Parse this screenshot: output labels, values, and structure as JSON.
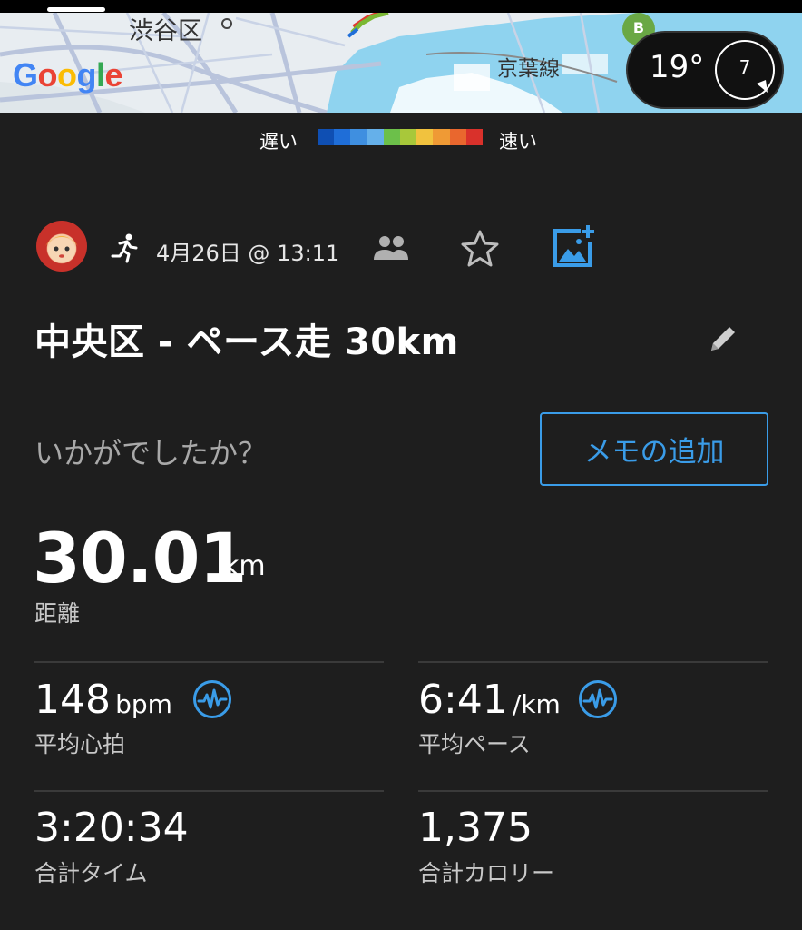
{
  "map": {
    "district_label": "渋谷区",
    "rail_label": "京葉線",
    "google_logo": "Google",
    "marker_letter": "B",
    "weather": {
      "temperature": "19°",
      "wind": "7"
    }
  },
  "pace_legend": {
    "slow_label": "遅い",
    "fast_label": "速い",
    "colors": [
      "#0f4fb3",
      "#1f6ed8",
      "#3f8fe0",
      "#65b0ea",
      "#6cc04a",
      "#a8c83a",
      "#f1c23e",
      "#ef9a35",
      "#e9672e",
      "#d9312b"
    ]
  },
  "activity": {
    "type_icon": "running-icon",
    "datetime": "4月26日 @ 13:11",
    "title": "中央区 - ペース走 30km",
    "prompt": "いかがでしたか？",
    "memo_button": "メモの追加"
  },
  "stats": {
    "distance": {
      "value": "30.01",
      "unit": "km",
      "label": "距離"
    },
    "avg_hr": {
      "value": "148",
      "unit": "bpm",
      "label": "平均心拍"
    },
    "avg_pace": {
      "value": "6:41",
      "unit": "/km",
      "label": "平均ペース"
    },
    "total_time": {
      "value": "3:20:34",
      "label": "合計タイム"
    },
    "calories": {
      "value": "1,375",
      "label": "合計カロリー"
    }
  },
  "colors": {
    "background": "#1e1e1e",
    "accent": "#3a9ce8"
  }
}
